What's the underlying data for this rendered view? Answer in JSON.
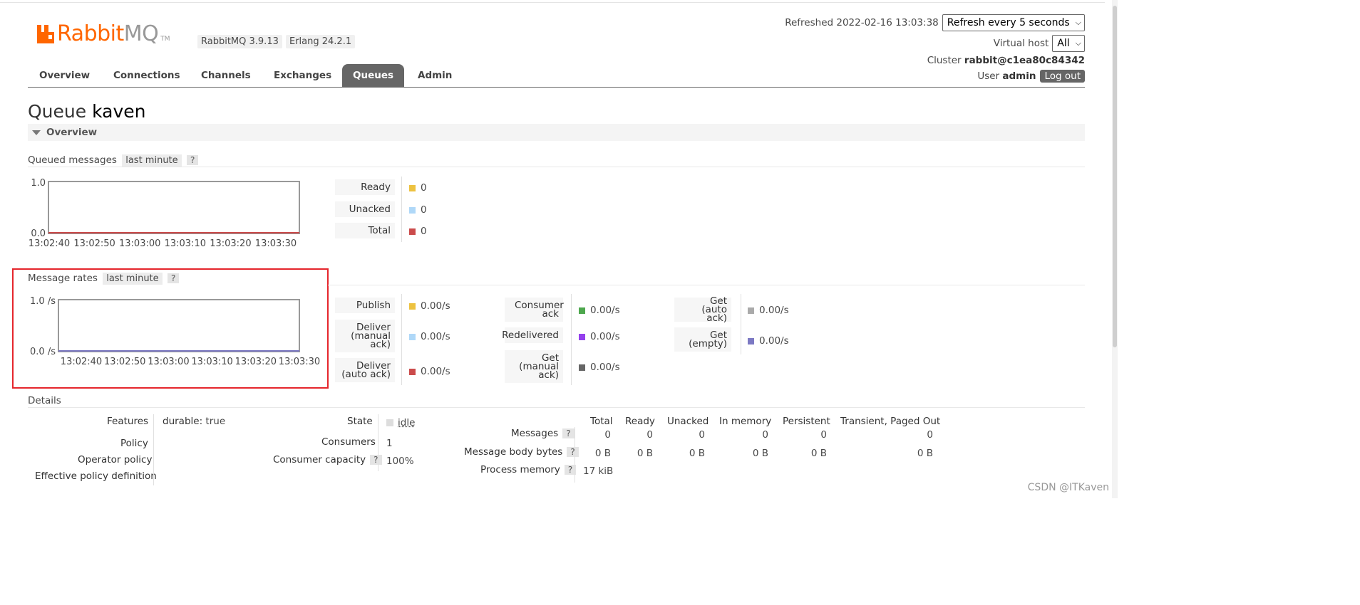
{
  "app": {
    "logo_text_a": "Rabbit",
    "logo_text_b": "MQ",
    "logo_tm": "TM",
    "version": "RabbitMQ 3.9.13",
    "erlang": "Erlang 24.2.1",
    "brand_color": "#ff6600"
  },
  "header": {
    "refreshed_label": "Refreshed 2022-02-16 13:03:38",
    "refresh_select": "Refresh every 5 seconds",
    "vhost_label": "Virtual host",
    "vhost_value": "All",
    "cluster_label": "Cluster",
    "cluster_value": "rabbit@c1ea80c84342",
    "user_label": "User",
    "user_value": "admin",
    "logout": "Log out"
  },
  "tabs": [
    "Overview",
    "Connections",
    "Channels",
    "Exchanges",
    "Queues",
    "Admin"
  ],
  "active_tab": "Queues",
  "page": {
    "title_prefix": "Queue",
    "title_name": "kaven",
    "section_overview": "Overview"
  },
  "queued": {
    "title": "Queued messages",
    "range": "last minute",
    "help": "?",
    "chart_data": {
      "type": "line",
      "x": [
        "13:02:40",
        "13:02:50",
        "13:03:00",
        "13:03:10",
        "13:03:20",
        "13:03:30"
      ],
      "y_ticks": [
        "1.0",
        "0.0"
      ],
      "ylim": [
        0,
        1
      ],
      "series": [
        {
          "name": "Ready",
          "values": [
            0,
            0,
            0,
            0,
            0,
            0
          ],
          "color": "#edc240"
        },
        {
          "name": "Unacked",
          "values": [
            0,
            0,
            0,
            0,
            0,
            0
          ],
          "color": "#afd8f8"
        },
        {
          "name": "Total",
          "values": [
            0,
            0,
            0,
            0,
            0,
            0
          ],
          "color": "#cb4b4b"
        }
      ]
    },
    "legend": [
      {
        "label": "Ready",
        "value": "0",
        "color": "#edc240"
      },
      {
        "label": "Unacked",
        "value": "0",
        "color": "#afd8f8"
      },
      {
        "label": "Total",
        "value": "0",
        "color": "#cb4b4b"
      }
    ]
  },
  "rates": {
    "title": "Message rates",
    "range": "last minute",
    "help": "?",
    "chart_data": {
      "type": "line",
      "x": [
        "13:02:40",
        "13:02:50",
        "13:03:00",
        "13:03:10",
        "13:03:20",
        "13:03:30"
      ],
      "y_ticks": [
        "1.0 /s",
        "0.0 /s"
      ],
      "ylim": [
        0,
        1
      ],
      "series": [
        {
          "name": "Publish",
          "values": [
            0,
            0,
            0,
            0,
            0,
            0
          ],
          "color": "#edc240"
        },
        {
          "name": "Get (empty)",
          "values": [
            0,
            0,
            0,
            0,
            0,
            0
          ],
          "color": "#7c79c3"
        }
      ]
    },
    "legend_col1": [
      {
        "label": "Publish",
        "value": "0.00/s",
        "color": "#edc240"
      },
      {
        "label": "Deliver (manual ack)",
        "value": "0.00/s",
        "color": "#afd8f8"
      },
      {
        "label": "Deliver (auto ack)",
        "value": "0.00/s",
        "color": "#cb4b4b"
      }
    ],
    "legend_col2": [
      {
        "label": "Consumer ack",
        "value": "0.00/s",
        "color": "#4da74d"
      },
      {
        "label": "Redelivered",
        "value": "0.00/s",
        "color": "#9440ed"
      },
      {
        "label": "Get (manual ack)",
        "value": "0.00/s",
        "color": "#666666"
      }
    ],
    "legend_col3": [
      {
        "label": "Get (auto ack)",
        "value": "0.00/s",
        "color": "#aaaaaa"
      },
      {
        "label": "Get (empty)",
        "value": "0.00/s",
        "color": "#7c79c3"
      }
    ]
  },
  "details": {
    "title": "Details",
    "features_label": "Features",
    "features_key": "durable:",
    "features_value": "true",
    "policy_label": "Policy",
    "operator_policy_label": "Operator policy",
    "effective_policy_label": "Effective policy definition",
    "state_label": "State",
    "state_value": "idle",
    "consumers_label": "Consumers",
    "consumers_value": "1",
    "capacity_label": "Consumer capacity",
    "capacity_value": "100%",
    "help": "?",
    "columns": [
      "Total",
      "Ready",
      "Unacked",
      "In memory",
      "Persistent",
      "Transient, Paged Out"
    ],
    "messages_label": "Messages",
    "messages_values": [
      "0",
      "0",
      "0",
      "0",
      "0",
      "0"
    ],
    "bytes_label": "Message body bytes",
    "bytes_values": [
      "0 B",
      "0 B",
      "0 B",
      "0 B",
      "0 B",
      "0 B"
    ],
    "memory_label": "Process memory",
    "memory_value": "17 kiB"
  },
  "watermark": "CSDN @ITKaven"
}
